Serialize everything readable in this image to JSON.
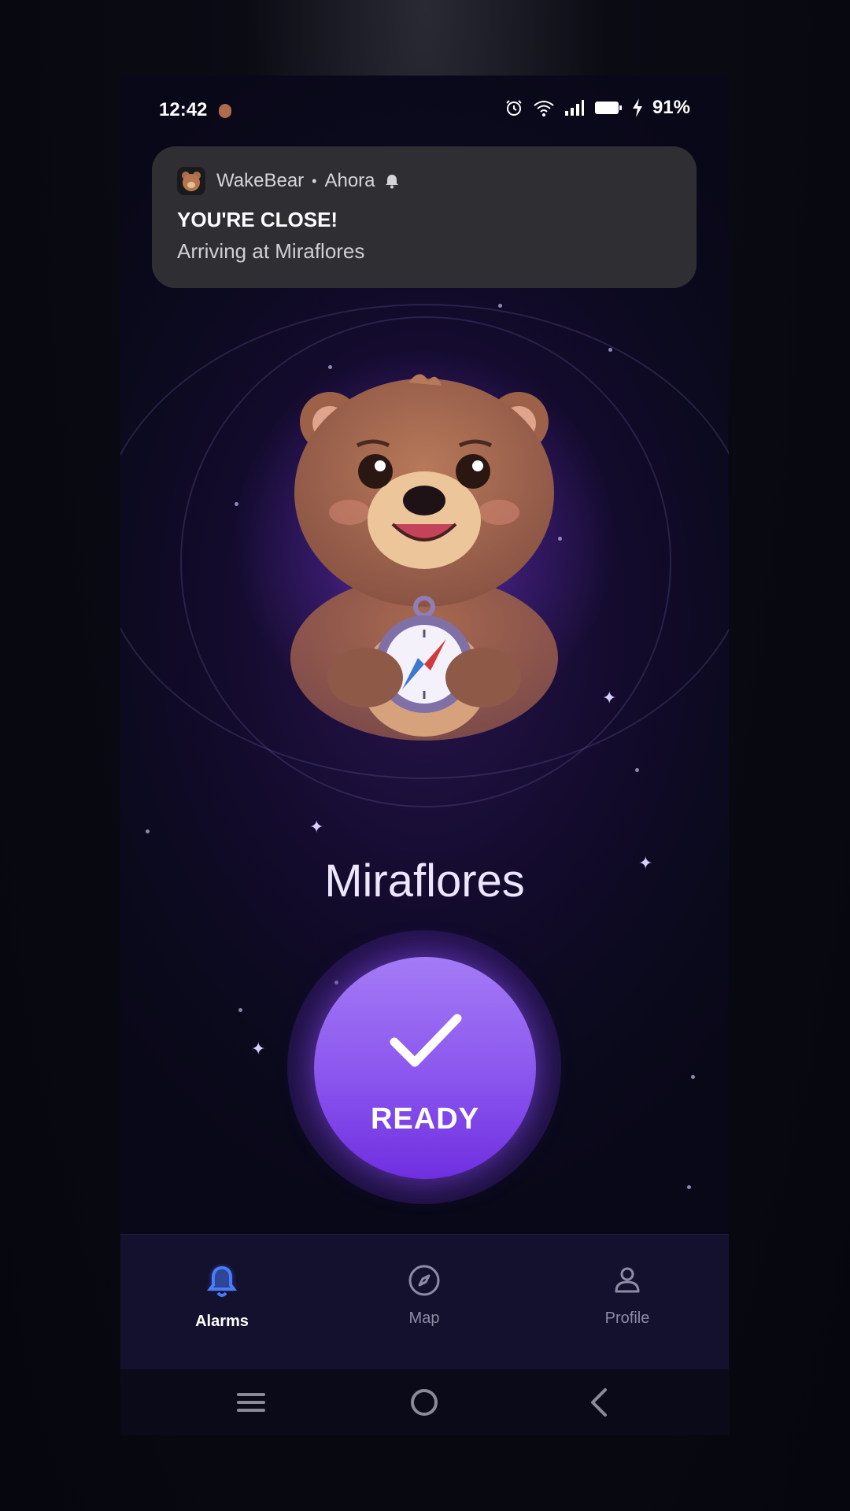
{
  "status_bar": {
    "time": "12:42",
    "battery": "91%"
  },
  "notification": {
    "app_name": "WakeBear",
    "separator": "•",
    "time_label": "Ahora",
    "title": "YOU'RE CLOSE!",
    "body": "Arriving at Miraflores"
  },
  "main": {
    "destination": "Miraflores",
    "ready_label": "READY"
  },
  "bottom_nav": {
    "items": [
      {
        "label": "Alarms",
        "icon": "bell-icon",
        "active": true
      },
      {
        "label": "Map",
        "icon": "compass-icon",
        "active": false
      },
      {
        "label": "Profile",
        "icon": "person-icon",
        "active": false
      }
    ]
  },
  "colors": {
    "accent": "#8a55ee",
    "nav_active": "#4a7bff",
    "background": "#0b0a1e"
  }
}
